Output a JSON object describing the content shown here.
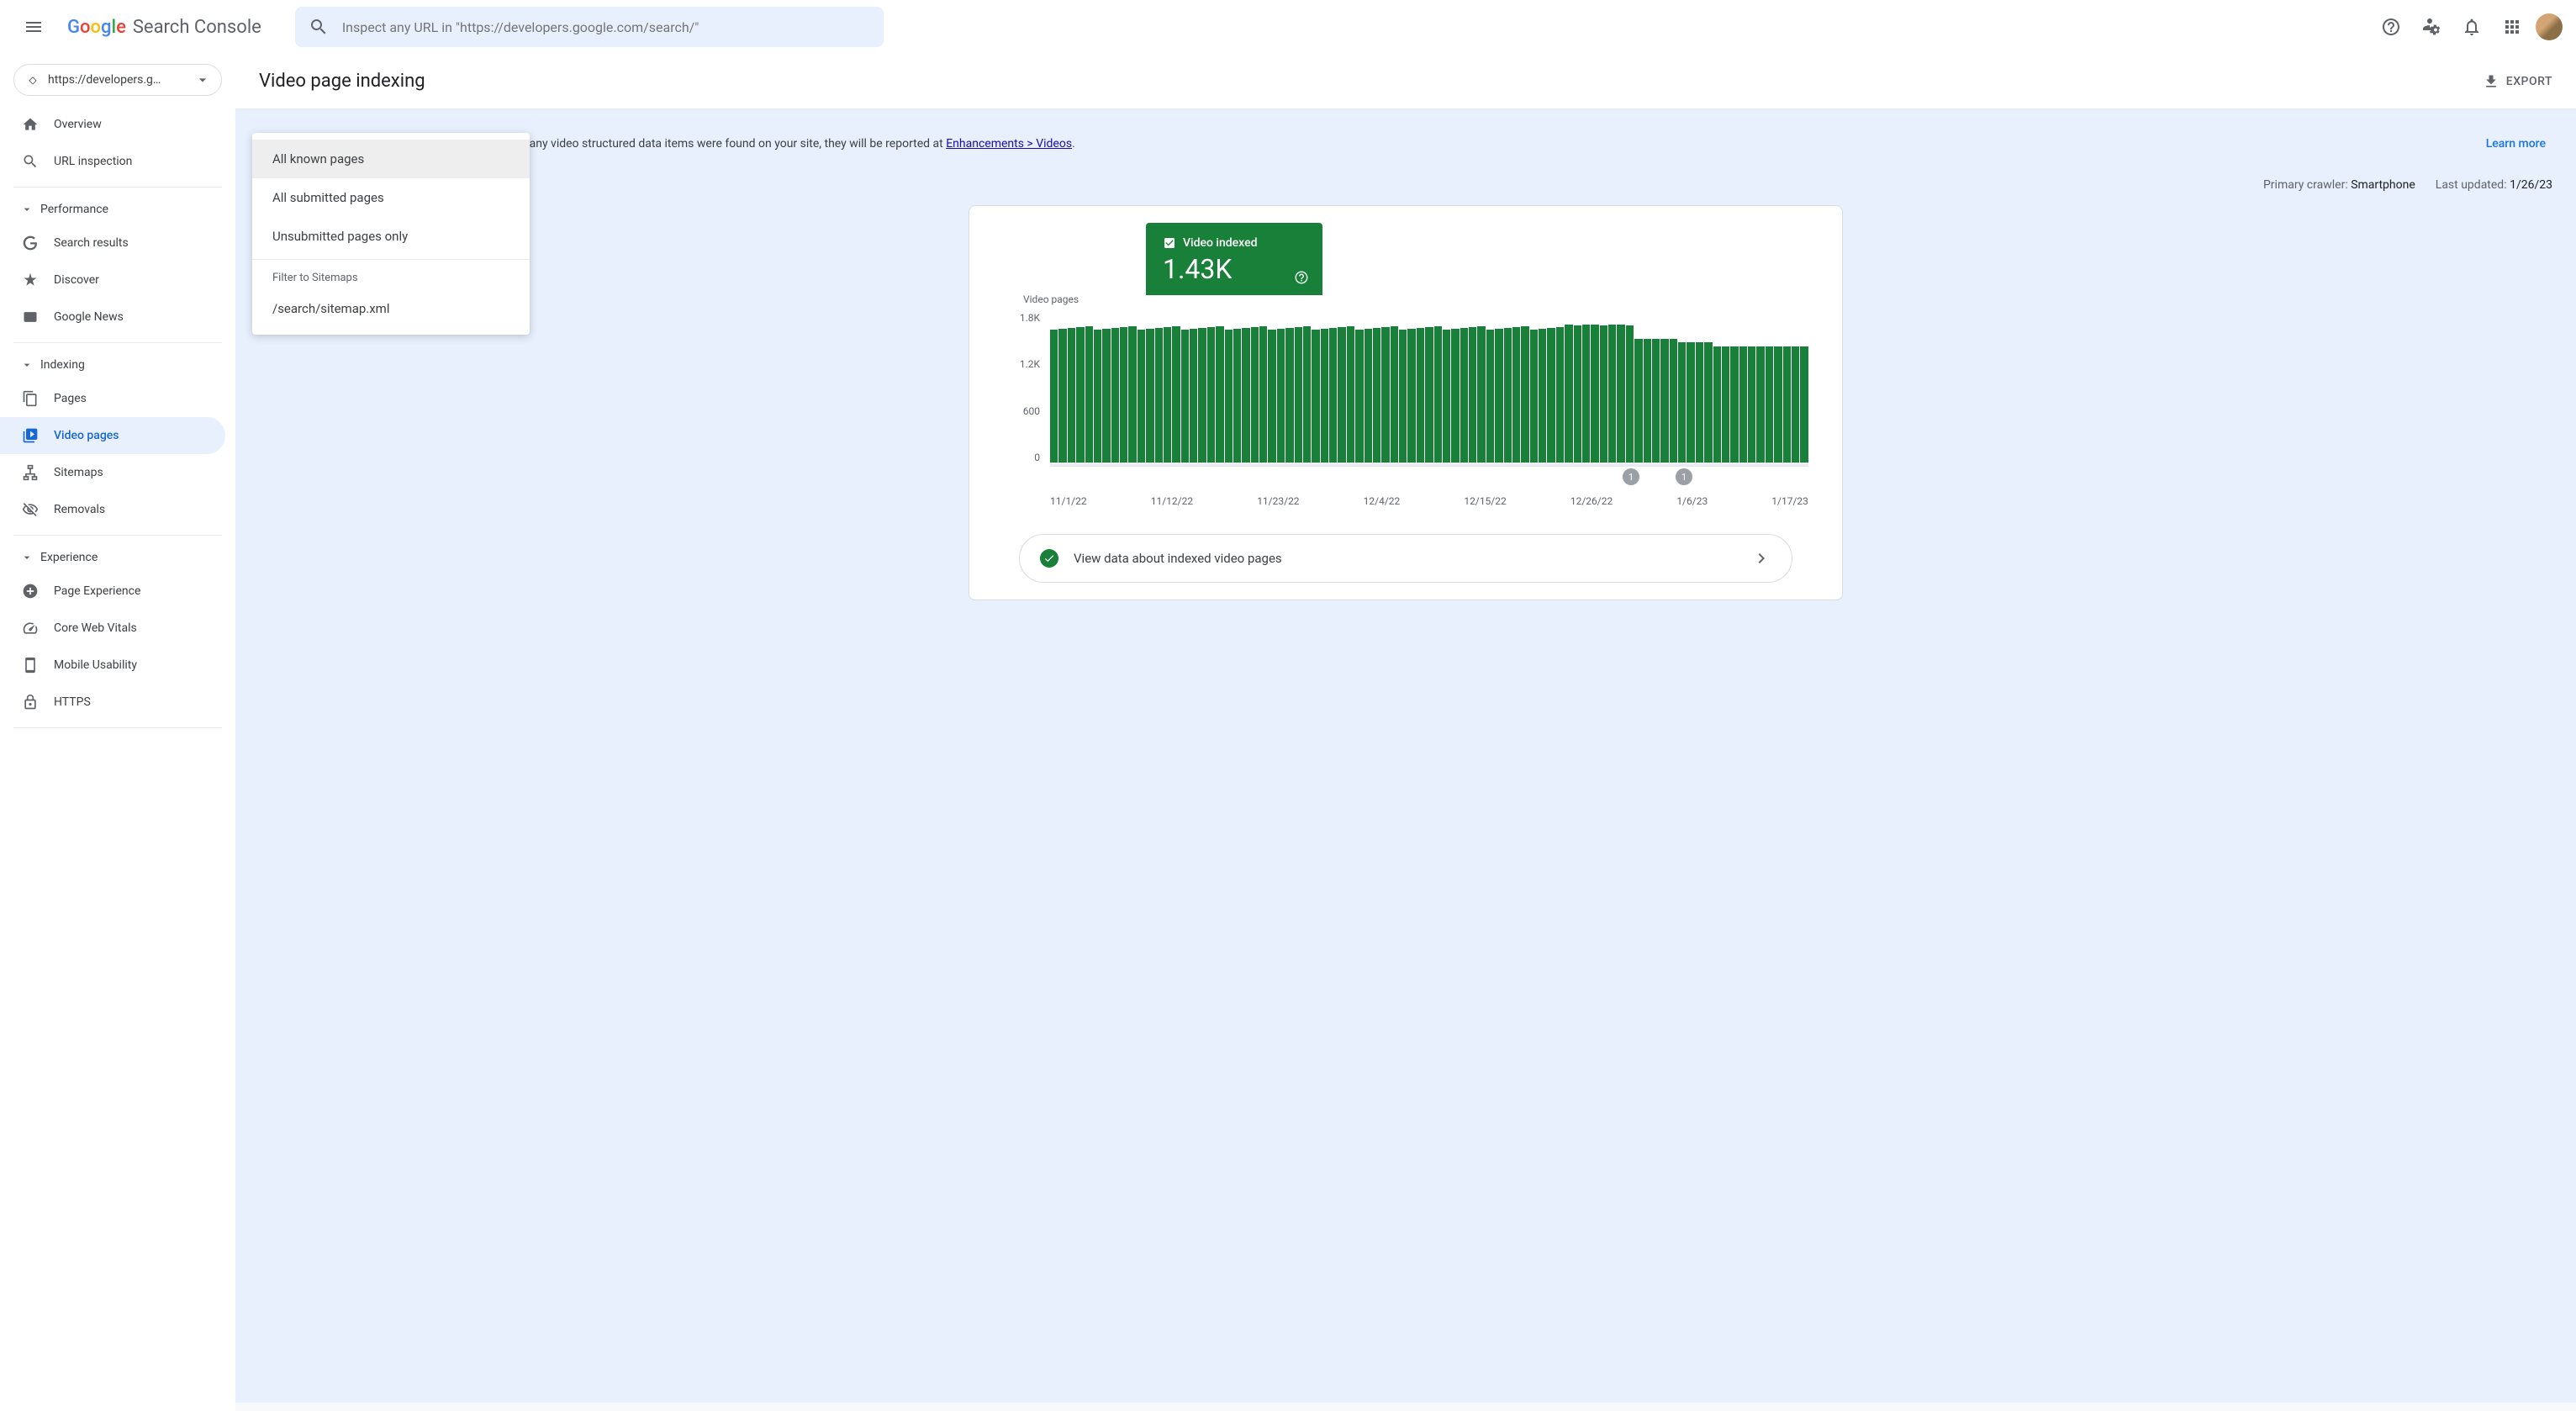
{
  "header": {
    "app_name": "Search Console",
    "search_placeholder": "Inspect any URL in \"https://developers.google.com/search/\""
  },
  "property": {
    "url": "https://developers.g…"
  },
  "nav": {
    "overview": "Overview",
    "url_inspection": "URL inspection",
    "performance": "Performance",
    "search_results": "Search results",
    "discover": "Discover",
    "google_news": "Google News",
    "indexing": "Indexing",
    "pages": "Pages",
    "video_pages": "Video pages",
    "sitemaps": "Sitemaps",
    "removals": "Removals",
    "experience": "Experience",
    "page_experience": "Page Experience",
    "core_web_vitals": "Core Web Vitals",
    "mobile_usability": "Mobile Usability",
    "https": "HTTPS"
  },
  "page": {
    "title": "Video page indexing",
    "export": "EXPORT",
    "banner_text": "This report is about video indexing status. If any video structured data items were found on your site, they will be reported at ",
    "banner_link": "Enhancements > Videos",
    "banner_suffix": ".",
    "learn_more": "Learn more",
    "primary_crawler_label": "Primary crawler:",
    "primary_crawler_value": "Smartphone",
    "last_updated_label": "Last updated:",
    "last_updated_value": "1/26/23"
  },
  "dropdown": {
    "all_known": "All known pages",
    "all_submitted": "All submitted pages",
    "unsubmitted": "Unsubmitted pages only",
    "filter_header": "Filter to Sitemaps",
    "sitemap": "/search/sitemap.xml"
  },
  "metric": {
    "label": "Video indexed",
    "value": "1.43K"
  },
  "chart": {
    "y_title": "Video pages",
    "y_ticks": [
      "1.8K",
      "1.2K",
      "600",
      "0"
    ],
    "x_ticks": [
      "11/1/22",
      "11/12/22",
      "11/23/22",
      "12/4/22",
      "12/15/22",
      "12/26/22",
      "1/6/23",
      "1/17/23"
    ],
    "marker1": "1",
    "marker2": "1"
  },
  "view_data": {
    "text": "View data about indexed video pages"
  },
  "chart_data": {
    "type": "bar",
    "title": "Video pages",
    "ylabel": "Video pages",
    "ylim": [
      0,
      1800
    ],
    "x_range": [
      "11/1/22",
      "1/26/23"
    ],
    "x_ticks": [
      "11/1/22",
      "11/12/22",
      "11/23/22",
      "12/4/22",
      "12/15/22",
      "12/26/22",
      "1/6/23",
      "1/17/23"
    ],
    "series": [
      {
        "name": "Video indexed",
        "approx_values_by_segment": [
          {
            "from": "11/1/22",
            "to": "12/29/22",
            "approx_value": 1620
          },
          {
            "from": "12/30/22",
            "to": "1/6/23",
            "approx_value": 1660
          },
          {
            "from": "1/7/23",
            "to": "1/11/23",
            "approx_value": 1500
          },
          {
            "from": "1/12/23",
            "to": "1/15/23",
            "approx_value": 1460
          },
          {
            "from": "1/16/23",
            "to": "1/26/23",
            "approx_value": 1400
          }
        ]
      }
    ],
    "event_markers": [
      {
        "date": "1/7/23",
        "label": "1"
      },
      {
        "date": "1/14/23",
        "label": "1"
      }
    ]
  }
}
